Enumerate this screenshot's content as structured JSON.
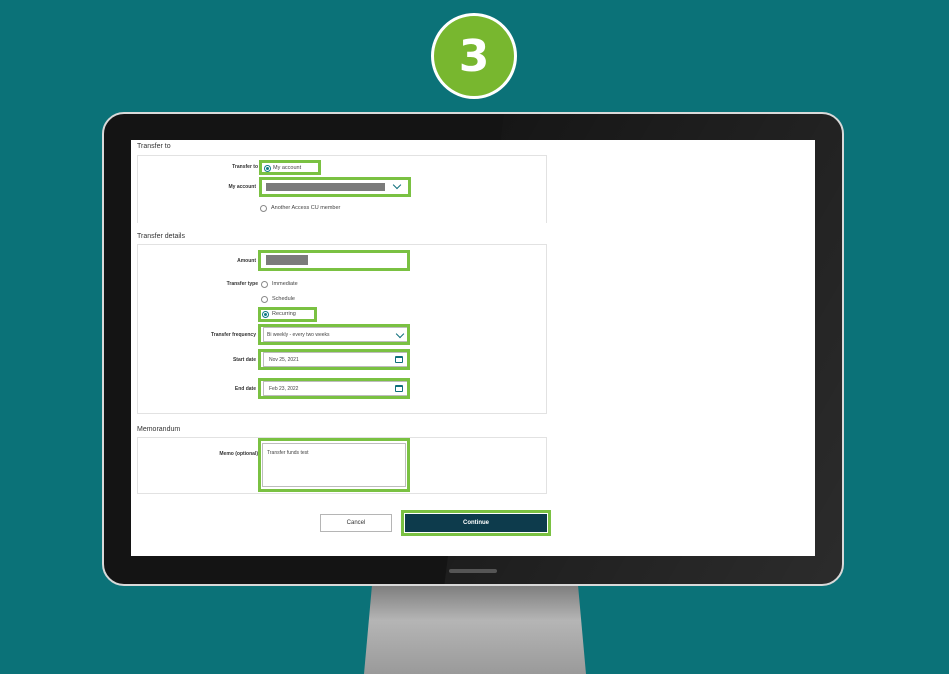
{
  "step": {
    "number": "3"
  },
  "form": {
    "transfer_to": {
      "section_title": "Transfer to",
      "label": "Transfer to",
      "option_my_account": "My account",
      "my_account_label": "My account",
      "option_other_member": "Another Access CU member"
    },
    "transfer_details": {
      "section_title": "Transfer details",
      "amount_label": "Amount",
      "transfer_type_label": "Transfer type",
      "options": [
        "Immediate",
        "Schedule",
        "Recurring"
      ],
      "selected_option": "Recurring",
      "frequency_label": "Transfer frequency",
      "frequency_value": "Bi weekly - every two weeks",
      "start_date_label": "Start date",
      "start_date_value": "Nov 25, 2021",
      "end_date_label": "End date",
      "end_date_value": "Feb 23, 2022"
    },
    "memorandum": {
      "section_title": "Memorandum",
      "memo_label": "Memo (optional)",
      "memo_value": "Transfer funds test"
    },
    "buttons": {
      "cancel": "Cancel",
      "continue": "Continue"
    }
  },
  "colors": {
    "background": "#0b7278",
    "highlight": "#7ac142",
    "badge": "#78b72f",
    "continue_button": "#0d3b4c",
    "accent": "#0f6f7c"
  },
  "icons": [
    "chevron-down-icon",
    "calendar-icon",
    "radio-button-icon"
  ]
}
